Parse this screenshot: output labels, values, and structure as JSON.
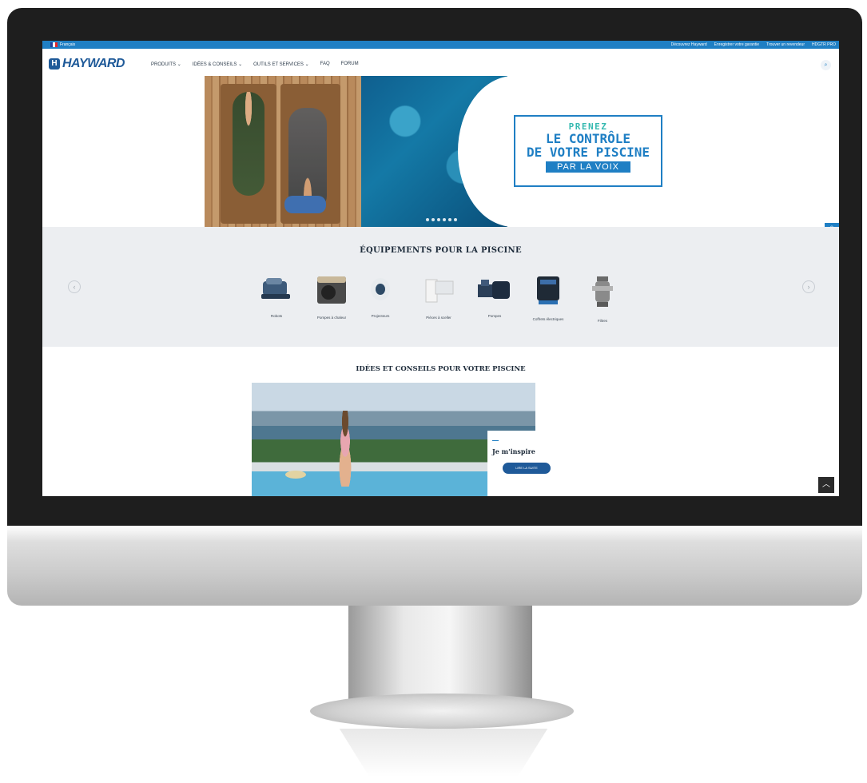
{
  "topbar": {
    "language": "Français",
    "links": [
      "Découvrez Hayward",
      "Enregistrer votre garantie",
      "Trouver un revendeur",
      "HDGTR PRO"
    ]
  },
  "brand": {
    "logo_text": "HAYWARD",
    "logo_mark": "H"
  },
  "nav": {
    "items": [
      {
        "label": "PRODUITS",
        "caret": "⌄"
      },
      {
        "label": "IDÉES & CONSEILS",
        "caret": "⌄"
      },
      {
        "label": "OUTILS ET SERVICES",
        "caret": "⌄"
      },
      {
        "label": "FAQ",
        "caret": ""
      },
      {
        "label": "FORUM",
        "caret": ""
      }
    ],
    "search_icon": "search-icon"
  },
  "hero": {
    "line1": "PRENEZ",
    "line2": "LE CONTRÔLE",
    "line3": "DE VOTRE PISCINE",
    "line4": "PAR LA VOIX",
    "slides_count": 6
  },
  "equipment": {
    "title": "ÉQUIPEMENTS POUR LA PISCINE",
    "products": [
      {
        "label": "Robots",
        "icon": "robot-icon"
      },
      {
        "label": "Pompes à chaleur",
        "icon": "heat-pump-icon"
      },
      {
        "label": "Projecteurs",
        "icon": "projector-icon"
      },
      {
        "label": "Pièces à sceller",
        "icon": "skimmer-icon"
      },
      {
        "label": "Pompes",
        "icon": "pump-icon"
      },
      {
        "label": "Coffrets électriques",
        "icon": "electric-box-icon"
      },
      {
        "label": "Filtres",
        "icon": "filter-icon"
      }
    ]
  },
  "ideas": {
    "title": "IDÉES ET CONSEILS POUR VOTRE PISCINE",
    "card_title": "Je m'inspire",
    "card_button": "LIRE LA SUITE"
  },
  "side_tools": [
    "location-icon",
    "mail-icon",
    "facebook-icon",
    "youtube-icon",
    "linkedin-icon",
    "pinterest-icon"
  ],
  "colors": {
    "brand_blue": "#1f7fc4",
    "logo_blue": "#1f5a99",
    "accent_teal": "#35b9b0"
  }
}
